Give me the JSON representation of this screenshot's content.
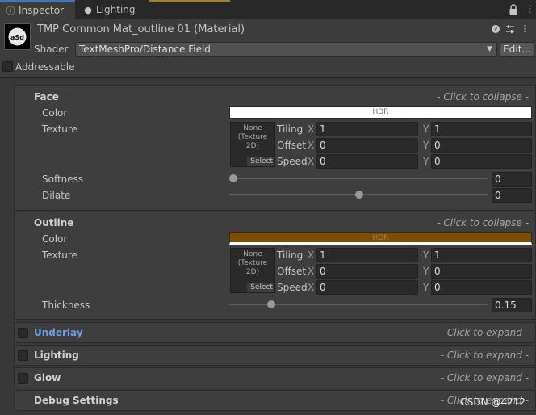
{
  "tabs": [
    {
      "label": "Inspector",
      "icon": "info-icon",
      "active": true
    },
    {
      "label": "Lighting",
      "icon": "lightbulb-icon",
      "active": false
    }
  ],
  "header": {
    "title": "TMP Common Mat_outline 01 (Material)",
    "shader_label": "Shader",
    "shader_value": "TextMeshPro/Distance Field",
    "edit_label": "Edit...",
    "addressable_label": "Addressable"
  },
  "face": {
    "title": "Face",
    "hint": "- Click to collapse -",
    "color_label": "Color",
    "color_hdr": "HDR",
    "color_value": "#ffffff",
    "texture_label": "Texture",
    "texture_none": "None\n(Texture\n2D)",
    "texture_select": "Select",
    "tiling_label": "Tiling",
    "offset_label": "Offset",
    "speed_label": "Speed",
    "axis_x": "X",
    "axis_y": "Y",
    "tiling_x": "1",
    "tiling_y": "1",
    "offset_x": "0",
    "offset_y": "0",
    "speed_x": "0",
    "speed_y": "0",
    "softness_label": "Softness",
    "softness_value": "0",
    "dilate_label": "Dilate",
    "dilate_value": "0"
  },
  "outline": {
    "title": "Outline",
    "hint": "- Click to collapse -",
    "color_label": "Color",
    "color_hdr": "HDR",
    "color_value": "#7a4f00",
    "texture_label": "Texture",
    "texture_none": "None\n(Texture\n2D)",
    "texture_select": "Select",
    "tiling_label": "Tiling",
    "offset_label": "Offset",
    "speed_label": "Speed",
    "axis_x": "X",
    "axis_y": "Y",
    "tiling_x": "1",
    "tiling_y": "1",
    "offset_x": "0",
    "offset_y": "0",
    "speed_x": "0",
    "speed_y": "0",
    "thickness_label": "Thickness",
    "thickness_value": "0.15"
  },
  "collapsed_sections": [
    {
      "title": "Underlay",
      "hint": "- Click to expand -"
    },
    {
      "title": "Lighting",
      "hint": "- Click to expand -"
    },
    {
      "title": "Glow",
      "hint": "- Click to expand -"
    },
    {
      "title": "Debug Settings",
      "hint": "- Click to expand -"
    }
  ],
  "watermark": "CSDN @4212",
  "colors": {
    "accent_tab": "#3a79bb",
    "underlay_title": "#6d9ee0"
  }
}
